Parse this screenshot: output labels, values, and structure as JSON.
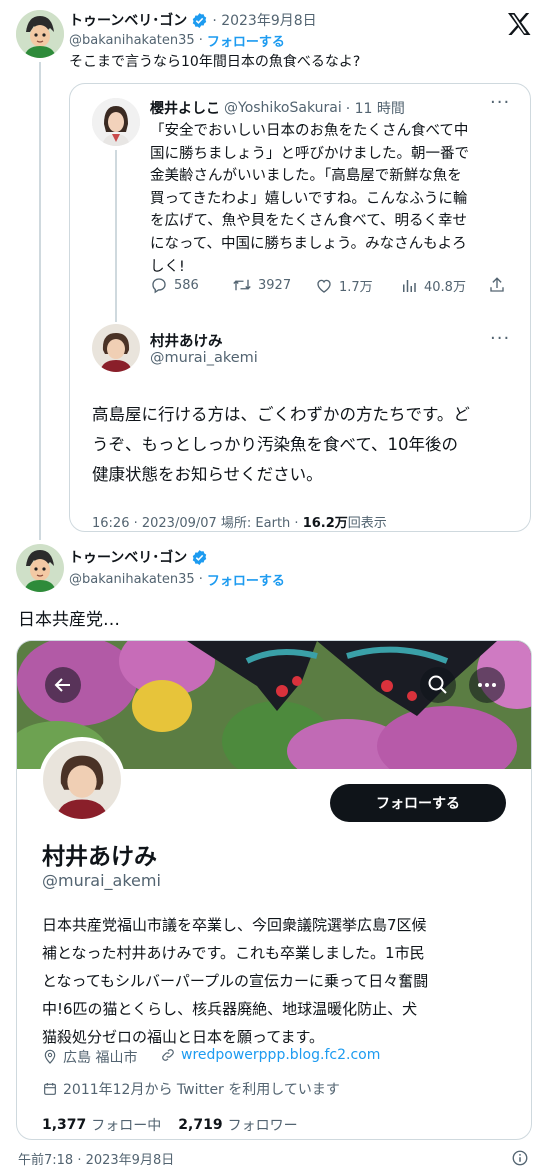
{
  "colors": {
    "accent": "#1d9bf0",
    "text": "#0f1419",
    "muted": "#536471",
    "border": "#cfd9de",
    "verified": "#1d9bf0"
  },
  "tweet1": {
    "display_name": "トゥーンベリ･ゴン",
    "date": "· 2023年9月8日",
    "handle": "@bakanihakaten35",
    "follow": "フォローする",
    "text": "そこまで言うなら10年間日本の魚食べるなよ?"
  },
  "quote": {
    "author": {
      "display_name": "櫻井よしこ",
      "handle": "@YoshikoSakurai",
      "time": "· 11 時間"
    },
    "text_lines": [
      "「安全でおいしい日本のお魚をたくさん食べて中",
      "国に勝ちましょう」と呼びかけました。朝一番で",
      "金美齢さんがいいました。「高島屋で新鮮な魚を",
      "買ってきたわよ」嬉しいですね。こんなふうに輪",
      "を広げて、魚や貝をたくさん食べて、明るく幸せ",
      "になって、中国に勝ちましょう。みなさんもよろ",
      "しく!"
    ],
    "actions": {
      "reply": "586",
      "retweet": "3927",
      "like": "1.7万",
      "views": "40.8万"
    },
    "reply": {
      "display_name": "村井あけみ",
      "handle": "@murai_akemi",
      "text_lines": [
        "高島屋に行ける方は、ごくわずかの方たちです。ど",
        "うぞ、もっとしっかり汚染魚を食べて、10年後の",
        "健康状態をお知らせください。"
      ],
      "meta": "16:26 · 2023/09/07 場所: Earth · ",
      "views_count": "16.2万",
      "views_suffix": "回表示"
    }
  },
  "tweet2": {
    "display_name": "トゥーンベリ･ゴン",
    "handle": "@bakanihakaten35",
    "follow": "フォローする",
    "text": "日本共産党…"
  },
  "profile_card": {
    "follow_button": "フォローする",
    "name": "村井あけみ",
    "handle": "@murai_akemi",
    "bio_lines": [
      "日本共産党福山市議を卒業し、今回衆議院選挙広島7区候",
      "補となった村井あけみです。これも卒業しました。1市民",
      "となってもシルバーパープルの宣伝カーに乗って日々奮闘",
      "中!6匹の猫とくらし、核兵器廃絶、地球温暖化防止、犬",
      "猫殺処分ゼロの福山と日本を願ってます。"
    ],
    "location": "広島 福山市",
    "website": "wredpowerppp.blog.fc2.com",
    "joined": "2011年12月から Twitter を利用しています",
    "following_count": "1,377",
    "following_label": "フォロー中",
    "followers_count": "2,719",
    "followers_label": "フォロワー"
  },
  "footer": {
    "timestamp": "午前7:18 · 2023年9月8日"
  }
}
